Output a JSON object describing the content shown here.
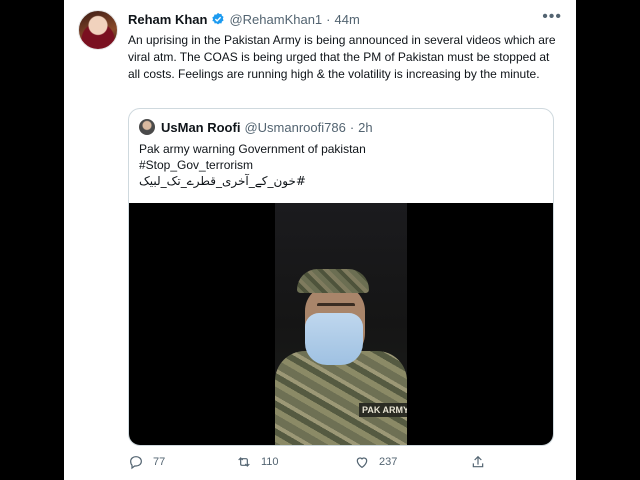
{
  "tweet": {
    "display_name": "Reham Khan",
    "handle": "@RehamKhan1",
    "separator": "·",
    "time": "44m",
    "more_icon": "more-horizontal-icon",
    "text": "An uprising in the Pakistan Army is being announced in several videos which are viral atm. The COAS is being urged that the PM of Pakistan must be stopped at all costs. Feelings are running high & the volatility is increasing by the minute."
  },
  "quote": {
    "display_name": "UsMan Roofi",
    "handle": "@Usmanroofi786",
    "separator": "·",
    "time": "2h",
    "line1": "Pak army warning Government of pakistan",
    "line2": "#Stop_Gov_terrorism",
    "line3": "#خون_کے_آخری_قطرے_تک_لبیک",
    "media_label": "PAK ARMY"
  },
  "actions": {
    "reply_count": "77",
    "retweet_count": "110",
    "like_count": "237"
  },
  "colors": {
    "verified": "#1d9bf0",
    "muted": "#536471",
    "border": "#cfd9de"
  }
}
